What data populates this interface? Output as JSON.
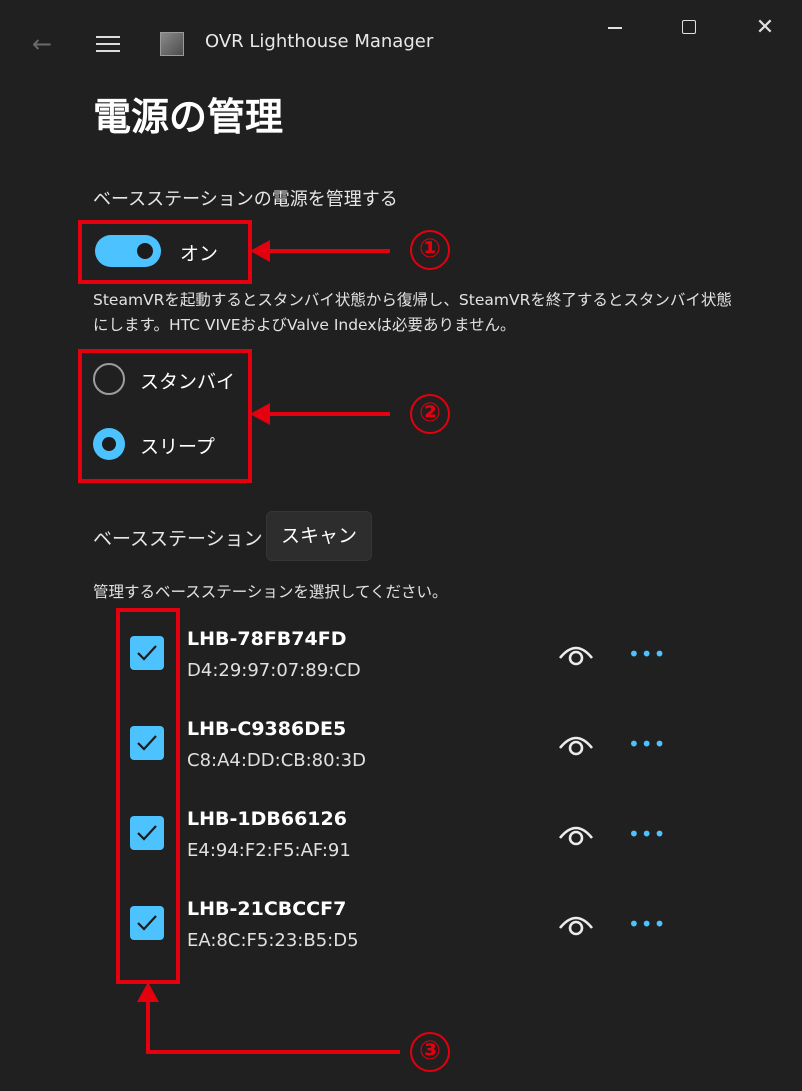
{
  "window": {
    "title": "OVR Lighthouse Manager",
    "back_glyph": "←",
    "close_glyph": "✕",
    "icons": [
      "back-arrow-icon",
      "hamburger-menu-icon",
      "app-icon",
      "minimize-icon",
      "maximize-icon",
      "close-icon"
    ]
  },
  "page": {
    "title": "電源の管理"
  },
  "power": {
    "section_label": "ベースステーションの電源を管理する",
    "toggle_state": "on",
    "toggle_label": "オン",
    "description": "SteamVRを起動するとスタンバイ状態から復帰し、SteamVRを終了するとスタンバイ状態にします。HTC VIVEおよびValve Indexは必要ありません。",
    "modes": [
      {
        "label": "スタンバイ",
        "selected": false
      },
      {
        "label": "スリープ",
        "selected": true
      }
    ]
  },
  "stations": {
    "label": "ベースステーション",
    "scan_label": "スキャン",
    "hint": "管理するベースステーションを選択してください。",
    "more_glyph": "•••",
    "items": [
      {
        "name": "LHB-78FB74FD",
        "mac": "D4:29:97:07:89:CD",
        "checked": true
      },
      {
        "name": "LHB-C9386DE5",
        "mac": "C8:A4:DD:CB:80:3D",
        "checked": true
      },
      {
        "name": "LHB-1DB66126",
        "mac": "E4:94:F2:F5:AF:91",
        "checked": true
      },
      {
        "name": "LHB-21CBCCF7",
        "mac": "EA:8C:F5:23:B5:D5",
        "checked": true
      }
    ]
  },
  "annotations": {
    "labels": [
      "①",
      "②",
      "③"
    ],
    "color": "#e3000f"
  },
  "colors": {
    "background": "#202020",
    "accent": "#4cc2ff",
    "annotation": "#e3000f"
  }
}
